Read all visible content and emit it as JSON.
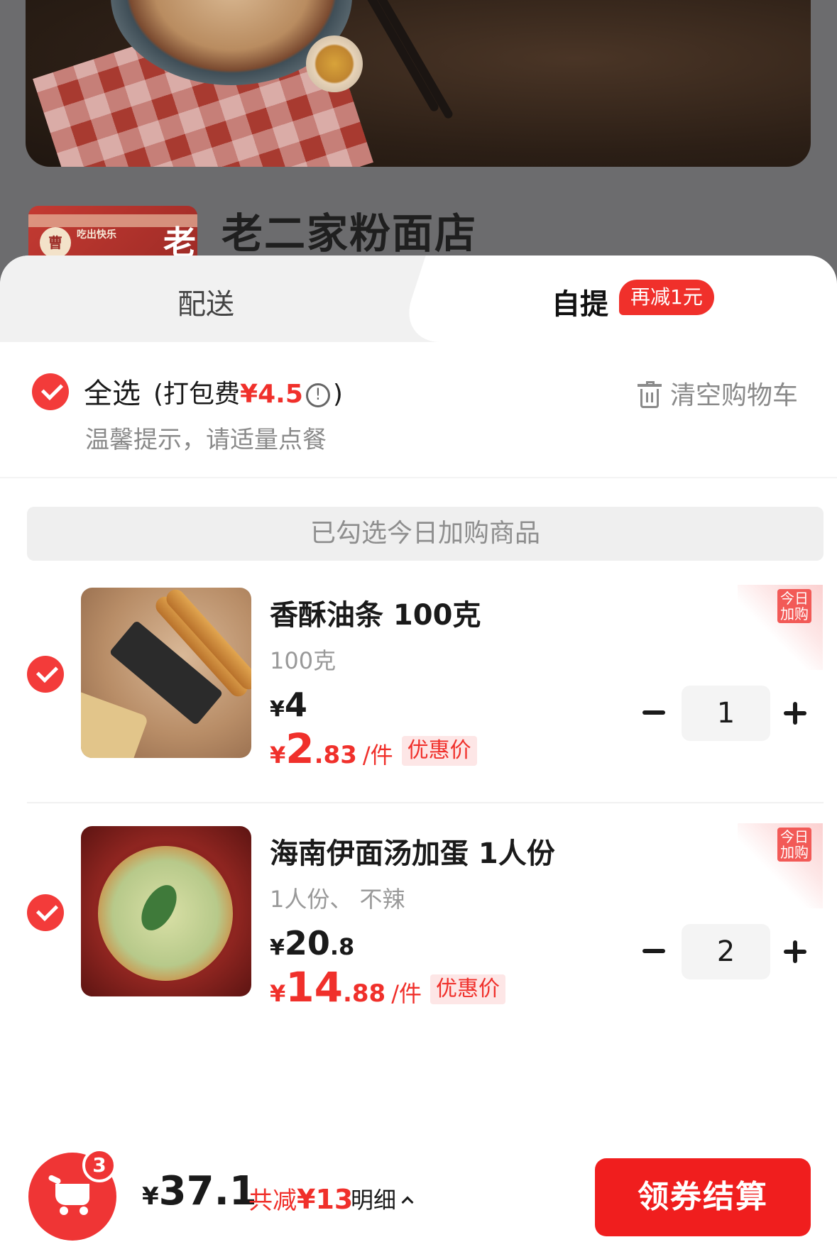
{
  "store": {
    "name": "老二家粉面店",
    "logo_slogan": "吃出快乐",
    "logo_char": "老",
    "logo_seal": "曹"
  },
  "tabs": [
    {
      "label": "配送",
      "active": false
    },
    {
      "label": "自提",
      "active": true,
      "badge": "再减1元"
    }
  ],
  "cart_header": {
    "select_all": "全选",
    "pack_fee_prefix": "(打包费",
    "pack_fee_amount": "¥4.5",
    "pack_fee_suffix": ")",
    "info_icon": "!",
    "clear_cart": "清空购物车",
    "tip": "温馨提示，请适量点餐"
  },
  "notice": "已勾选今日加购商品",
  "items": [
    {
      "name": "香酥油条 100克",
      "spec": "100克",
      "orig_yen": "¥",
      "orig_int": "4",
      "orig_dec": "",
      "deal_yen": "¥",
      "deal_int": "2",
      "deal_dec": ".83",
      "unit": "/件",
      "deal_tag": "优惠价",
      "today_tag": "今日加购",
      "quantity": "1"
    },
    {
      "name": "海南伊面汤加蛋 1人份",
      "spec": "1人份、 不辣",
      "orig_yen": "¥",
      "orig_int": "20",
      "orig_dec": ".8",
      "deal_yen": "¥",
      "deal_int": "14",
      "deal_dec": ".88",
      "unit": "/件",
      "deal_tag": "优惠价",
      "today_tag": "今日加购",
      "quantity": "2"
    }
  ],
  "bottom_bar": {
    "cart_count": "3",
    "total_yen": "¥",
    "total_amount": "37.1",
    "saved_prefix": "共减",
    "saved_amount": "¥13",
    "detail": "明细",
    "checkout": "领券结算"
  },
  "colors": {
    "accent": "#f0302b",
    "checkout_bg": "#f01e1e",
    "tab_inactive_bg": "#f1f1f1"
  },
  "icons": [
    "check-icon",
    "info-icon",
    "trash-icon",
    "cart-icon",
    "chevron-up-icon",
    "minus-icon",
    "plus-icon"
  ]
}
